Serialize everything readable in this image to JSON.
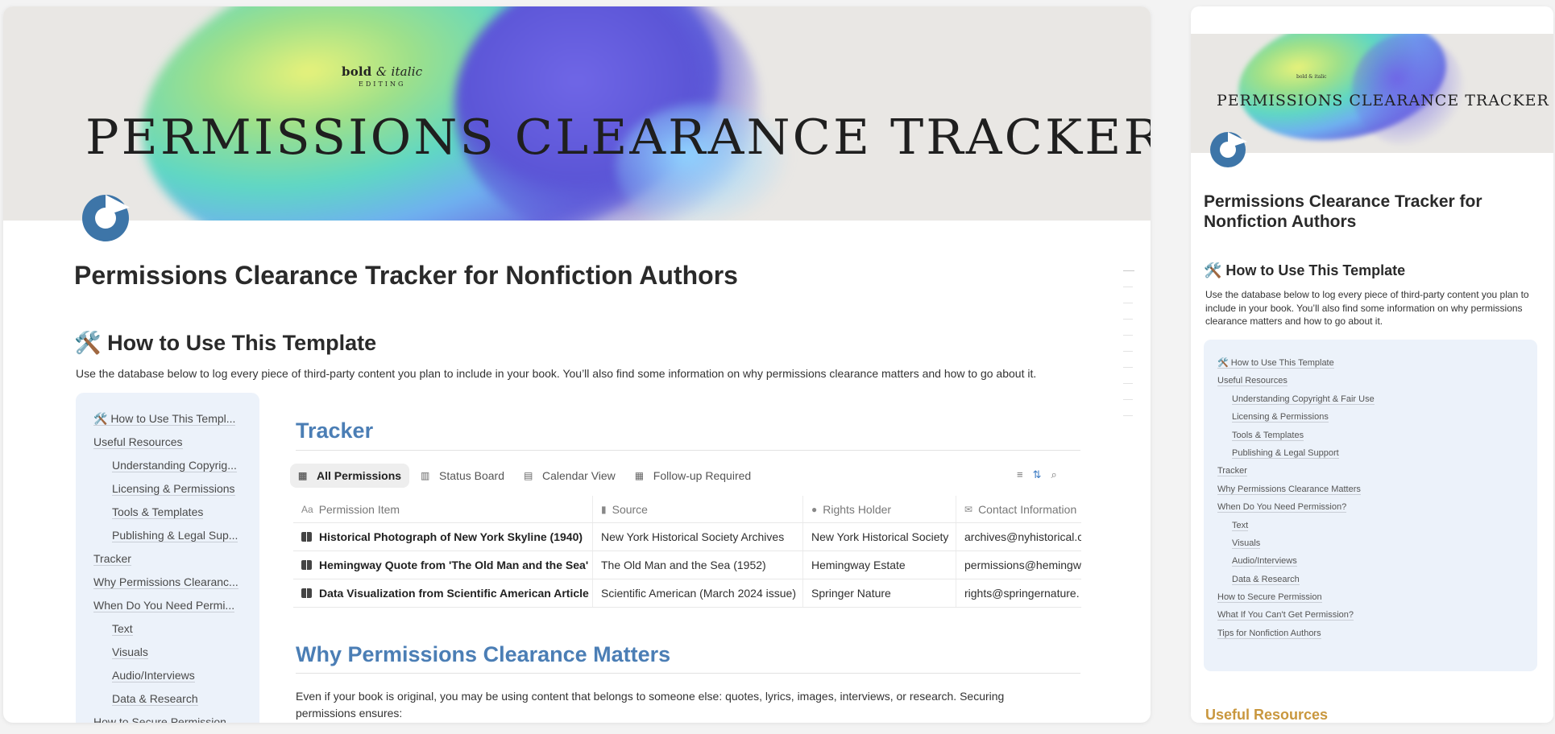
{
  "cover": {
    "brand_main": "bold",
    "brand_amp": "& italic",
    "brand_sub": "EDITING",
    "title": "PERMISSIONS CLEARANCE TRACKER"
  },
  "page": {
    "title": "Permissions Clearance Tracker for Nonfiction Authors",
    "how_to_heading": "🛠️ How to Use This Template",
    "intro": "Use the database below to log every piece of third-party content you plan to include in your book. You’ll also find some information on why permissions clearance matters and how to go about it."
  },
  "toc": [
    {
      "label": "🛠️ How to Use This Templ...",
      "sub": false
    },
    {
      "label": "Useful Resources",
      "sub": false
    },
    {
      "label": "Understanding Copyrig...",
      "sub": true
    },
    {
      "label": "Licensing & Permissions",
      "sub": true
    },
    {
      "label": "Tools & Templates",
      "sub": true
    },
    {
      "label": "Publishing & Legal Sup...",
      "sub": true
    },
    {
      "label": "Tracker",
      "sub": false
    },
    {
      "label": "Why Permissions Clearanc...",
      "sub": false
    },
    {
      "label": "When Do You Need Permi...",
      "sub": false
    },
    {
      "label": "Text",
      "sub": true
    },
    {
      "label": "Visuals",
      "sub": true
    },
    {
      "label": "Audio/Interviews",
      "sub": true
    },
    {
      "label": "Data & Research",
      "sub": true
    },
    {
      "label": "How to Secure Permission",
      "sub": false
    }
  ],
  "tracker": {
    "heading": "Tracker",
    "views": [
      {
        "label": "All Permissions",
        "icon": "table-icon",
        "active": true
      },
      {
        "label": "Status Board",
        "icon": "board-icon",
        "active": false
      },
      {
        "label": "Calendar View",
        "icon": "calendar-icon",
        "active": false
      },
      {
        "label": "Follow-up Required",
        "icon": "table-icon",
        "active": false
      }
    ],
    "columns": [
      "Permission Item",
      "Source",
      "Rights Holder",
      "Contact Information"
    ],
    "rows": [
      [
        "Historical Photograph of New York Skyline (1940)",
        "New York Historical Society Archives",
        "New York Historical Society",
        "archives@nyhistorical.c"
      ],
      [
        "Hemingway Quote from 'The Old Man and the Sea'",
        "The Old Man and the Sea (1952)",
        "Hemingway Estate",
        "permissions@hemingw"
      ],
      [
        "Data Visualization from Scientific American Article",
        "Scientific American (March 2024 issue)",
        "Springer Nature",
        "rights@springernature."
      ]
    ]
  },
  "why": {
    "heading": "Why Permissions Clearance Matters",
    "paragraph": "Even if your book is original, you may be using content that belongs to someone else: quotes, lyrics, images, interviews, or research. Securing permissions ensures:"
  },
  "side": {
    "cover_brand": "bold & italic",
    "cover_title": "PERMISSIONS CLEARANCE TRACKER",
    "title": "Permissions Clearance Tracker for Nonfiction Authors",
    "how_to_heading": "🛠️ How to Use This Template",
    "intro": "Use the database below to log every piece of third-party content you plan to include in your book. You’ll also find some information on why permissions clearance matters and how to go about it.",
    "toc": [
      {
        "label": "🛠️ How to Use This Template",
        "sub": false
      },
      {
        "label": "Useful Resources",
        "sub": false
      },
      {
        "label": "Understanding Copyright & Fair Use",
        "sub": true
      },
      {
        "label": "Licensing & Permissions",
        "sub": true
      },
      {
        "label": "Tools & Templates",
        "sub": true
      },
      {
        "label": "Publishing & Legal Support",
        "sub": true
      },
      {
        "label": "Tracker",
        "sub": false
      },
      {
        "label": "Why Permissions Clearance Matters",
        "sub": false
      },
      {
        "label": "When Do You Need Permission?",
        "sub": false
      },
      {
        "label": "Text",
        "sub": true
      },
      {
        "label": "Visuals",
        "sub": true
      },
      {
        "label": "Audio/Interviews",
        "sub": true
      },
      {
        "label": "Data & Research",
        "sub": true
      },
      {
        "label": "How to Secure Permission",
        "sub": false
      },
      {
        "label": "What If You Can't Get Permission?",
        "sub": false
      },
      {
        "label": "Tips for Nonfiction Authors",
        "sub": false
      }
    ],
    "useful_heading": "Useful Resources"
  },
  "colors": {
    "accent_blue": "#4b7eb5",
    "toc_bg": "#ecf2fa",
    "useful_gold": "#c9973e",
    "page_icon": "#3d75a8"
  }
}
